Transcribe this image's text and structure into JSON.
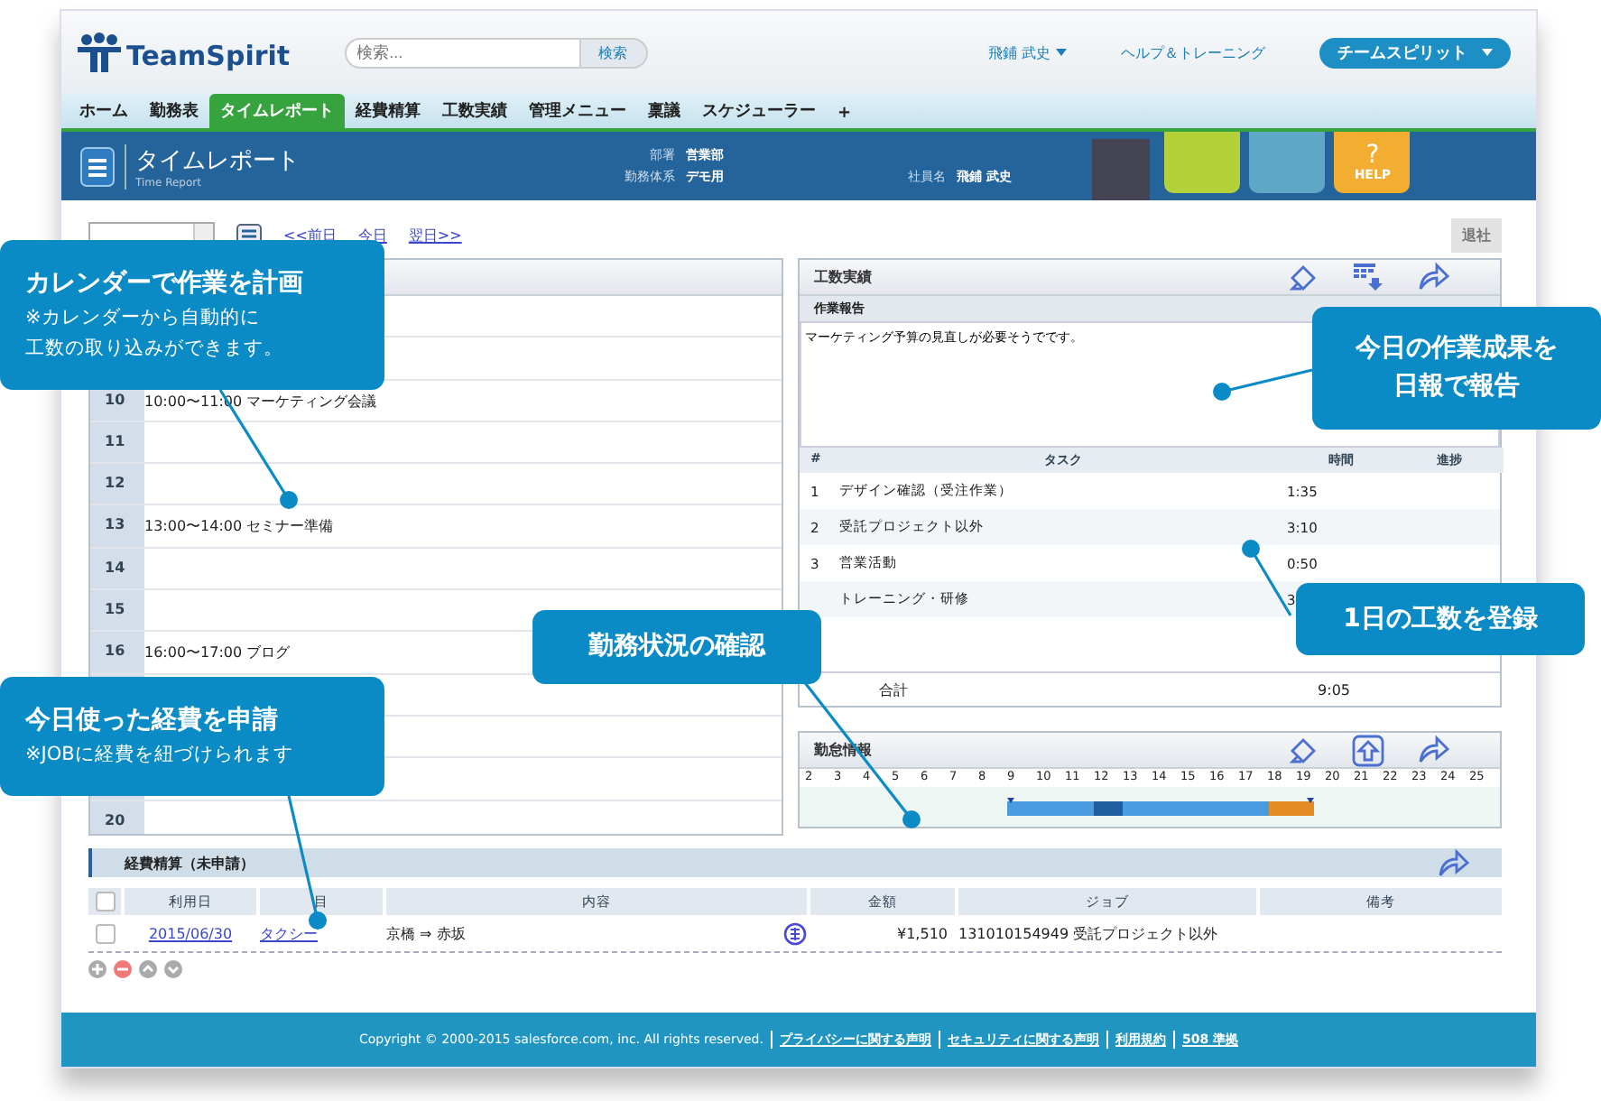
{
  "header": {
    "logo": "TeamSpirit",
    "search": {
      "placeholder": "検索...",
      "button": "検索"
    },
    "user_menu": "飛鋪 武史",
    "help_link": "ヘルプ＆トレーニング",
    "app_menu": "チームスピリット"
  },
  "tabs": [
    {
      "label": "ホーム",
      "selected": false
    },
    {
      "label": "勤務表",
      "selected": false
    },
    {
      "label": "タイムレポート",
      "selected": true
    },
    {
      "label": "経費精算",
      "selected": false
    },
    {
      "label": "工数実績",
      "selected": false
    },
    {
      "label": "管理メニュー",
      "selected": false
    },
    {
      "label": "稟議",
      "selected": false
    },
    {
      "label": "スケジューラー",
      "selected": false
    },
    {
      "label": "+",
      "selected": false
    }
  ],
  "banner": {
    "title": "タイムレポート",
    "subtitle": "Time Report",
    "fields": [
      {
        "label": "部署",
        "value": "営業部"
      },
      {
        "label": "勤務体系",
        "value": "デモ用"
      },
      {
        "label": "社員名",
        "value": "飛鋪 武史"
      }
    ],
    "tiles": [
      {
        "color": "#b5d13a"
      },
      {
        "color": "#5ea7c6"
      },
      {
        "color": "#f3ae32",
        "symbol": "?",
        "label": "HELP"
      }
    ]
  },
  "date_nav": {
    "links": [
      "<<前日",
      "今日",
      "翌日>>"
    ],
    "leave_button": {
      "label": "退社",
      "disabled": true
    }
  },
  "calendar": {
    "rows": [
      {},
      {},
      {
        "hour": "10",
        "event": "10:00〜11:00 マーケティング会議"
      },
      {
        "hour": "11"
      },
      {
        "hour": "12"
      },
      {
        "hour": "13",
        "event": "13:00〜14:00 セミナー準備"
      },
      {
        "hour": "14"
      },
      {
        "hour": "15"
      },
      {
        "hour": "16",
        "event": "16:00〜17:00 ブログ"
      },
      {},
      {},
      {},
      {
        "hour": "20"
      }
    ]
  },
  "work_report": {
    "title": "工数実績",
    "report_label": "作業報告",
    "report_text": "マーケティング予算の見直しが必要そうでです。",
    "columns": [
      "#",
      "タスク",
      "時間",
      "進捗"
    ],
    "tasks": [
      {
        "no": "1",
        "task": "デザイン確認（受注作業）",
        "time": "1:35"
      },
      {
        "no": "2",
        "task": "受託プロジェクト以外",
        "time": "3:10"
      },
      {
        "no": "3",
        "task": "営業活動",
        "time": "0:50"
      },
      {
        "task": "トレーニング・研修",
        "time": "3"
      }
    ],
    "total": {
      "label": "合計",
      "time": "9:05"
    }
  },
  "attendance": {
    "title": "勤怠情報",
    "hours": [
      "2",
      "3",
      "4",
      "5",
      "6",
      "7",
      "8",
      "9",
      "10",
      "11",
      "12",
      "13",
      "14",
      "15",
      "16",
      "17",
      "18",
      "19",
      "20",
      "21",
      "22",
      "23",
      "24",
      "25"
    ]
  },
  "expenses": {
    "title": "経費精算（未申請）",
    "select_all": {
      "checked": false
    },
    "columns": [
      "利用日",
      "目",
      "内容",
      "金額",
      "ジョブ",
      "備考"
    ],
    "rows": [
      {
        "checked": false,
        "date": "2015/06/30",
        "item": "タクシー",
        "detail": "京橋 ⇒ 赤坂",
        "amount": "¥1,510",
        "job": "131010154949 受託プロジェクト以外"
      }
    ]
  },
  "footer": {
    "copyright": "Copyright © 2000-2015 salesforce.com, inc. All rights reserved.",
    "links": [
      "プライバシーに関する声明",
      "セキュリティに関する声明",
      "利用規約",
      "508 準拠"
    ]
  },
  "callouts": [
    {
      "title": [
        "カレンダーで作業を計画"
      ],
      "note": [
        "※カレンダーから自動的に",
        "工数の取り込みができます。"
      ]
    },
    {
      "title": [
        "今日使った経費を申請"
      ],
      "note": [
        "※JOBに経費を紐づけられます"
      ]
    },
    {
      "title": [
        "勤務状況の確認"
      ]
    },
    {
      "title": [
        "今日の作業成果を",
        "日報で報告"
      ]
    },
    {
      "title": [
        "1日の工数を登録"
      ]
    }
  ]
}
